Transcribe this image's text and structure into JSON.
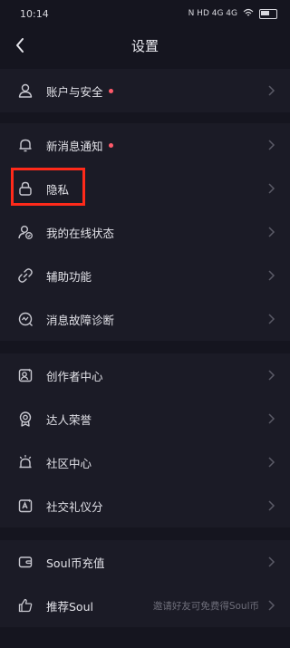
{
  "status_bar": {
    "time": "10:14",
    "icons_text": "N HD 4G 4G"
  },
  "nav": {
    "title": "设置"
  },
  "section1": [
    {
      "label": "账户与安全",
      "icon": "person-icon",
      "dot": true
    }
  ],
  "section2": [
    {
      "label": "新消息通知",
      "icon": "bell-icon",
      "dot": true
    },
    {
      "label": "隐私",
      "icon": "lock-icon",
      "dot": false
    },
    {
      "label": "我的在线状态",
      "icon": "online-status-icon",
      "dot": false
    },
    {
      "label": "辅助功能",
      "icon": "link-icon",
      "dot": false
    },
    {
      "label": "消息故障诊断",
      "icon": "diagnose-icon",
      "dot": false
    }
  ],
  "section3": [
    {
      "label": "创作者中心",
      "icon": "creator-icon",
      "dot": false
    },
    {
      "label": "达人荣誉",
      "icon": "medal-icon",
      "dot": false
    },
    {
      "label": "社区中心",
      "icon": "alarm-icon",
      "dot": false
    },
    {
      "label": "社交礼仪分",
      "icon": "etiquette-icon",
      "dot": false
    }
  ],
  "section4": [
    {
      "label": "Soul币充值",
      "icon": "wallet-icon",
      "dot": false
    },
    {
      "label": "推荐Soul",
      "icon": "thumb-up-icon",
      "dot": false,
      "hint": "邀请好友可免费得Soul币"
    }
  ],
  "colors": {
    "background": "#15151f",
    "row_bg": "#1b1b26",
    "dot": "#ff5a6a",
    "highlight": "#ff2a1a"
  }
}
